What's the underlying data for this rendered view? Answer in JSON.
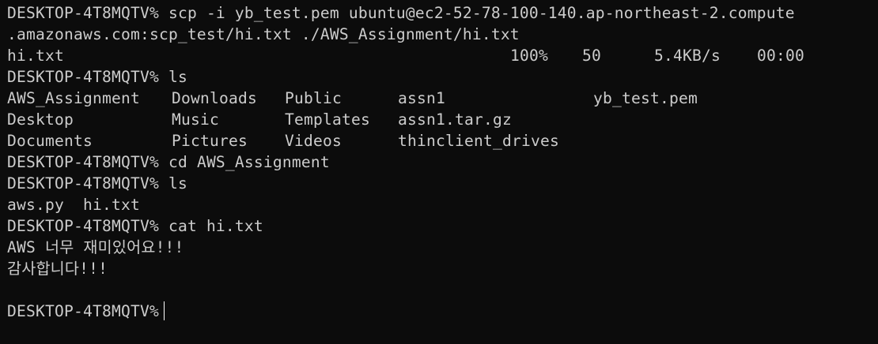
{
  "terminal": {
    "prompt": "DESKTOP-4T8MQTV%",
    "lines": {
      "scp_cmd_1": "scp -i yb_test.pem ubuntu@ec2-52-78-100-140.ap-northeast-2.compute",
      "scp_cmd_2": ".amazonaws.com:scp_test/hi.txt ./AWS_Assignment/hi.txt",
      "cmd_ls_1": "ls",
      "cmd_cd": "cd AWS_Assignment",
      "cmd_ls_2": "ls",
      "ls_2_output": "aws.py  hi.txt",
      "cmd_cat": "cat hi.txt",
      "cat_output_1": "AWS 너무 재미있어요!!!",
      "cat_output_2": "감사합니다!!!",
      "empty_line": ""
    },
    "transfer": {
      "file": "hi.txt",
      "percent": "100%",
      "size": "50",
      "rate": "5.4KB/s",
      "eta": "00:00"
    },
    "ls_1_rows": [
      [
        "AWS_Assignment",
        "Downloads",
        "Public",
        "assn1",
        "yb_test.pem"
      ],
      [
        "Desktop",
        "Music",
        "Templates",
        "assn1.tar.gz",
        ""
      ],
      [
        "Documents",
        "Pictures",
        "Videos",
        "thinclient_drives",
        ""
      ]
    ]
  }
}
